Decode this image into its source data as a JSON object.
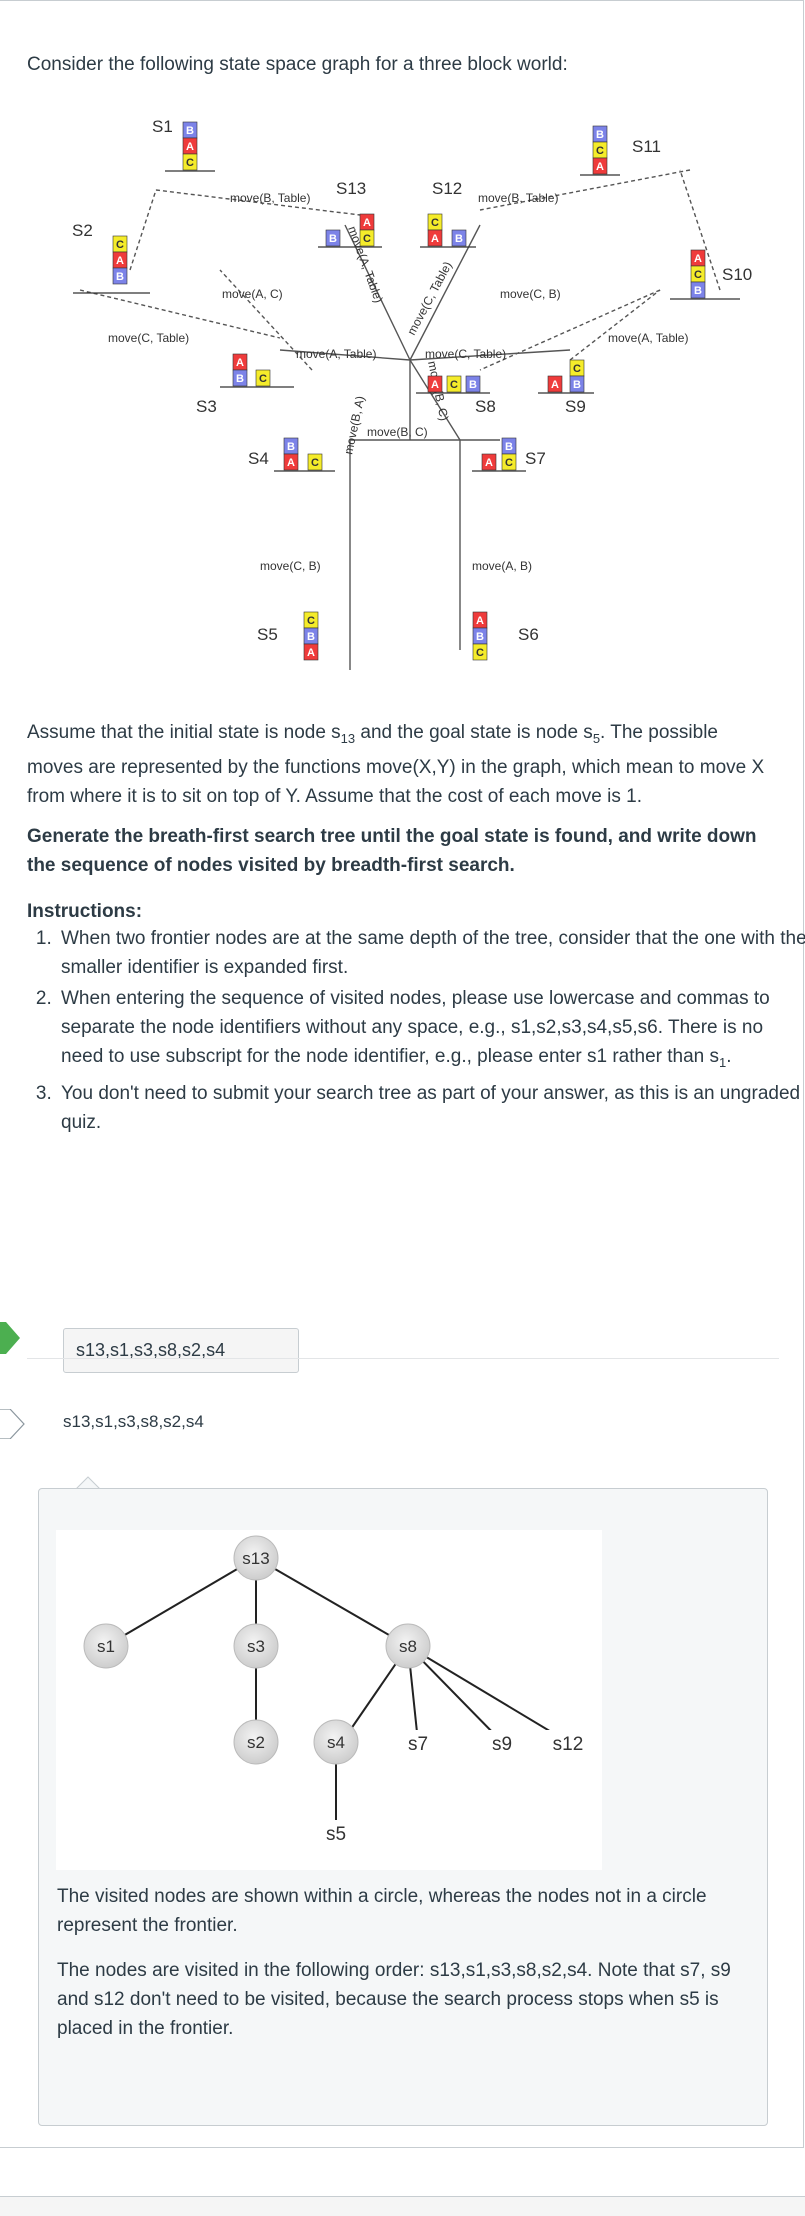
{
  "question": {
    "intro": "Consider the following state space graph for a three block world:",
    "para1_a": "Assume that the initial state is node s",
    "para1_sub1": "13",
    "para1_b": " and the goal state is node s",
    "para1_sub2": "5",
    "para1_c": ". The possible moves are represented by the functions move(X,Y) in the graph, which mean to move X from where it is to sit on top of Y. Assume that the cost of each move is 1.",
    "task": "Generate the breath-first search tree until the goal state is found, and write down the sequence of nodes visited by breadth-first search.",
    "instructions_heading": "Instructions:",
    "instructions": [
      "When two frontier nodes are at the same depth of the tree, consider that the one with the smaller identifier is expanded first.",
      "When entering the sequence of visited nodes, please use lowercase and commas to separate the node identifiers without any space, e.g., s1,s2,s3,s4,s5,s6. There is no need to use subscript for the node identifier, e.g., please enter s1 rather than s",
      "You don't need to submit your search tree as part of your answer, as this is an ungraded quiz."
    ],
    "instruction2_sub": "1",
    "instruction2_end": "."
  },
  "graph": {
    "states": [
      "S1",
      "S2",
      "S3",
      "S4",
      "S5",
      "S6",
      "S7",
      "S8",
      "S9",
      "S10",
      "S11",
      "S12",
      "S13"
    ],
    "moves": [
      "move(B, Table)",
      "move(B, Table)",
      "move(A, C)",
      "move(C, B)",
      "move(C, Table)",
      "move(A, Table)",
      "move(A, Table)",
      "move(C, Table)",
      "move(A, Table)",
      "move(C, Table)",
      "move(B, A)",
      "move(B, C)",
      "move(B, C)",
      "move(C, B)",
      "move(A, B)"
    ],
    "blocks": [
      "A",
      "B",
      "C"
    ],
    "colors": {
      "A": "#ef3b3b",
      "B": "#7c83e8",
      "C": "#f5ec2a"
    }
  },
  "answer": {
    "user_answer": "s13,s1,s3,s8,s2,s4",
    "correct_answer": "s13,s1,s3,s8,s2,s4",
    "status_color": "#4caf50"
  },
  "tree": {
    "nodes": [
      "s13",
      "s1",
      "s3",
      "s8",
      "s2",
      "s4",
      "s7",
      "s9",
      "s12",
      "s5"
    ]
  },
  "comment": {
    "p1": "The visited nodes are shown within a circle, whereas the nodes not in a circle represent the frontier.",
    "p2": "The nodes are visited in the following order: s13,s1,s3,s8,s2,s4. Note that s7, s9 and s12 don't need to be visited, because the search process stops when s5 is placed in the frontier."
  }
}
